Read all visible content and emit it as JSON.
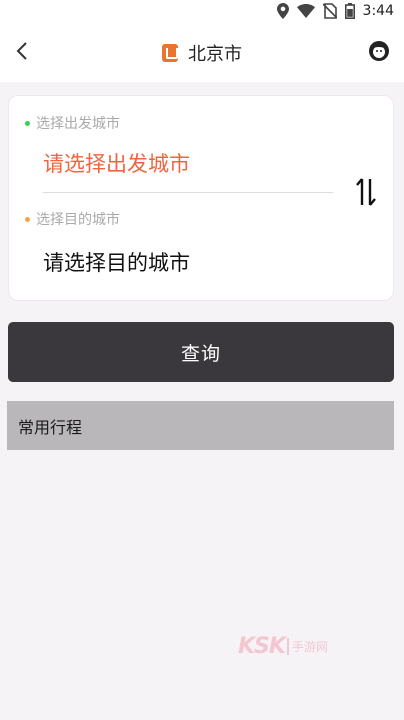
{
  "status_bar": {
    "time": "3:44",
    "icons": [
      "location-icon",
      "wifi-icon",
      "no-sim-icon",
      "battery-icon"
    ]
  },
  "header": {
    "title": "北京市",
    "back_icon": "chevron-left-icon",
    "logo_icon": "city-logo-icon",
    "avatar_icon": "user-avatar-icon"
  },
  "route_form": {
    "from": {
      "label": "选择出发城市",
      "placeholder": "请选择出发城市",
      "dot_color": "#35d05a"
    },
    "to": {
      "label": "选择目的城市",
      "placeholder": "请选择目的城市",
      "dot_color": "#f0a24a"
    },
    "swap_icon": "swap-vertical-icon"
  },
  "query_button": {
    "label": "查询"
  },
  "frequent_trips": {
    "title": "常用行程"
  },
  "watermark": {
    "text": "KSK",
    "sub": "手游网"
  },
  "colors": {
    "accent": "#f0653d",
    "button_bg": "#3b383d",
    "section_bg": "#b9b7ba",
    "page_bg": "#f5f3f6"
  }
}
